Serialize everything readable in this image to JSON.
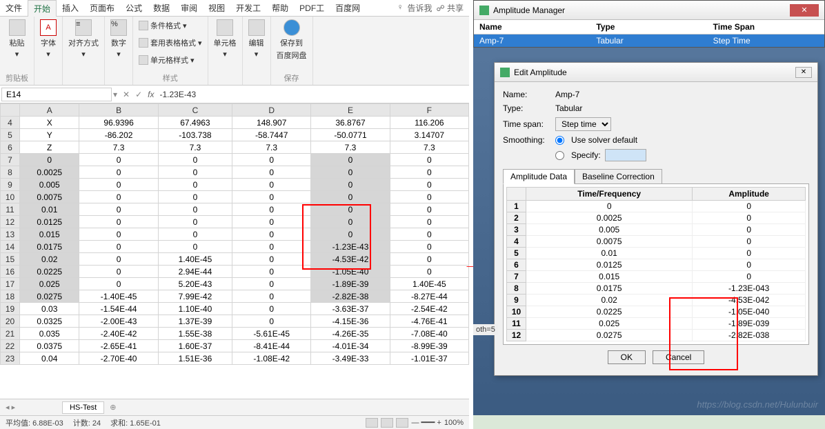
{
  "excel": {
    "tabs": [
      "文件",
      "开始",
      "插入",
      "页面布",
      "公式",
      "数据",
      "审阅",
      "视图",
      "开发工",
      "帮助",
      "PDF工",
      "百度网"
    ],
    "active_tab": "开始",
    "tell_me": "告诉我",
    "share": "共享",
    "ribbon": {
      "clipboard": {
        "paste": "粘贴",
        "label": "剪贴板"
      },
      "font": {
        "btn": "字体",
        "label": ""
      },
      "align": {
        "btn": "对齐方式",
        "label": ""
      },
      "number": {
        "btn": "数字",
        "label": ""
      },
      "styles": {
        "cond": "条件格式",
        "table": "套用表格格式",
        "cell": "单元格样式",
        "label": "样式"
      },
      "cells": {
        "btn": "单元格",
        "label": ""
      },
      "editing": {
        "btn": "编辑",
        "label": ""
      },
      "save": {
        "btn": "保存到",
        "btn2": "百度网盘",
        "label": "保存"
      }
    },
    "name_box": "E14",
    "formula": "-1.23E-43",
    "columns": [
      "A",
      "B",
      "C",
      "D",
      "E",
      "F"
    ],
    "row_start": 4,
    "rows": [
      {
        "r": 4,
        "c": [
          "X",
          "96.9396",
          "67.4963",
          "148.907",
          "36.8767",
          "116.206"
        ]
      },
      {
        "r": 5,
        "c": [
          "Y",
          "-86.202",
          "-103.738",
          "-58.7447",
          "-50.0771",
          "3.14707"
        ]
      },
      {
        "r": 6,
        "c": [
          "Z",
          "7.3",
          "7.3",
          "7.3",
          "7.3",
          "7.3"
        ]
      },
      {
        "r": 7,
        "c": [
          "0",
          "0",
          "0",
          "0",
          "0",
          "0"
        ],
        "sel": [
          0,
          4
        ]
      },
      {
        "r": 8,
        "c": [
          "0.0025",
          "0",
          "0",
          "0",
          "0",
          "0"
        ],
        "sel": [
          0,
          4
        ]
      },
      {
        "r": 9,
        "c": [
          "0.005",
          "0",
          "0",
          "0",
          "0",
          "0"
        ],
        "sel": [
          0,
          4
        ]
      },
      {
        "r": 10,
        "c": [
          "0.0075",
          "0",
          "0",
          "0",
          "0",
          "0"
        ],
        "sel": [
          0,
          4
        ]
      },
      {
        "r": 11,
        "c": [
          "0.01",
          "0",
          "0",
          "0",
          "0",
          "0"
        ],
        "sel": [
          0,
          4
        ]
      },
      {
        "r": 12,
        "c": [
          "0.0125",
          "0",
          "0",
          "0",
          "0",
          "0"
        ],
        "sel": [
          0,
          4
        ]
      },
      {
        "r": 13,
        "c": [
          "0.015",
          "0",
          "0",
          "0",
          "0",
          "0"
        ],
        "sel": [
          0,
          4
        ]
      },
      {
        "r": 14,
        "c": [
          "0.0175",
          "0",
          "0",
          "0",
          "-1.23E-43",
          "0"
        ],
        "sel": [
          0,
          4
        ]
      },
      {
        "r": 15,
        "c": [
          "0.02",
          "0",
          "1.40E-45",
          "0",
          "-4.53E-42",
          "0"
        ],
        "sel": [
          0,
          4
        ]
      },
      {
        "r": 16,
        "c": [
          "0.0225",
          "0",
          "2.94E-44",
          "0",
          "-1.05E-40",
          "0"
        ],
        "sel": [
          0,
          4
        ]
      },
      {
        "r": 17,
        "c": [
          "0.025",
          "0",
          "5.20E-43",
          "0",
          "-1.89E-39",
          "1.40E-45"
        ],
        "sel": [
          0,
          4
        ]
      },
      {
        "r": 18,
        "c": [
          "0.0275",
          "-1.40E-45",
          "7.99E-42",
          "0",
          "-2.82E-38",
          "-8.27E-44"
        ],
        "sel": [
          0,
          4
        ]
      },
      {
        "r": 19,
        "c": [
          "0.03",
          "-1.54E-44",
          "1.10E-40",
          "0",
          "-3.63E-37",
          "-2.54E-42"
        ]
      },
      {
        "r": 20,
        "c": [
          "0.0325",
          "-2.00E-43",
          "1.37E-39",
          "0",
          "-4.15E-36",
          "-4.76E-41"
        ]
      },
      {
        "r": 21,
        "c": [
          "0.035",
          "-2.40E-42",
          "1.55E-38",
          "-5.61E-45",
          "-4.26E-35",
          "-7.08E-40"
        ]
      },
      {
        "r": 22,
        "c": [
          "0.0375",
          "-2.65E-41",
          "1.60E-37",
          "-8.41E-44",
          "-4.01E-34",
          "-8.99E-39"
        ]
      },
      {
        "r": 23,
        "c": [
          "0.04",
          "-2.70E-40",
          "1.51E-36",
          "-1.08E-42",
          "-3.49E-33",
          "-1.01E-37"
        ]
      }
    ],
    "sheet": "HS-Test",
    "status": {
      "avg": "平均值: 6.88E-03",
      "count": "计数: 24",
      "sum": "求和: 1.65E-01",
      "zoom": "100%"
    }
  },
  "amp_mgr": {
    "title": "Amplitude Manager",
    "cols": [
      "Name",
      "Type",
      "Time Span"
    ],
    "row": [
      "Amp-7",
      "Tabular",
      "Step Time"
    ]
  },
  "edit": {
    "title": "Edit Amplitude",
    "name_label": "Name:",
    "name": "Amp-7",
    "type_label": "Type:",
    "type": "Tabular",
    "timespan_label": "Time span:",
    "timespan": "Step time",
    "smoothing_label": "Smoothing:",
    "solver": "Use solver default",
    "specify": "Specify:",
    "tab1": "Amplitude Data",
    "tab2": "Baseline Correction",
    "col1": "Time/Frequency",
    "col2": "Amplitude",
    "rows": [
      [
        "1",
        "0",
        "0"
      ],
      [
        "2",
        "0.0025",
        "0"
      ],
      [
        "3",
        "0.005",
        "0"
      ],
      [
        "4",
        "0.0075",
        "0"
      ],
      [
        "5",
        "0.01",
        "0"
      ],
      [
        "6",
        "0.0125",
        "0"
      ],
      [
        "7",
        "0.015",
        "0"
      ],
      [
        "8",
        "0.0175",
        "-1.23E-043"
      ],
      [
        "9",
        "0.02",
        "-4.53E-042"
      ],
      [
        "10",
        "0.0225",
        "-1.05E-040"
      ],
      [
        "11",
        "0.025",
        "-1.89E-039"
      ],
      [
        "12",
        "0.0275",
        "-2.82E-038"
      ]
    ],
    "ok": "OK",
    "cancel": "Cancel"
  },
  "oth": "oth=5",
  "watermark": "https://blog.csdn.net/Hulunbuir"
}
